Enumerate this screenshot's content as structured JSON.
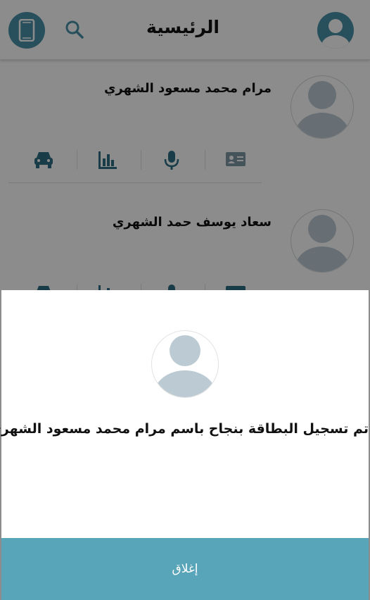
{
  "header": {
    "title": "الرئيسية",
    "icons": {
      "left_button": "phone-icon",
      "search": "search-icon",
      "profile": "avatar-icon"
    }
  },
  "cards": [
    {
      "name": "مرام محمد مسعود الشهري",
      "actions": [
        "car-icon",
        "chart-icon",
        "microphone-icon",
        "id-card-icon"
      ]
    },
    {
      "name": "سعاد يوسف حمد الشهري",
      "actions": [
        "car-icon",
        "chart-icon",
        "microphone-icon",
        "id-card-icon"
      ]
    }
  ],
  "dialog": {
    "message": "تم تسجيل البطاقة بنجاح باسم مرام محمد مسعود الشهري",
    "close_label": "إغلاق"
  },
  "colors": {
    "accent": "#4a90a8",
    "close_bar": "#58a4b9",
    "avatar_fill": "#bccbd3"
  }
}
